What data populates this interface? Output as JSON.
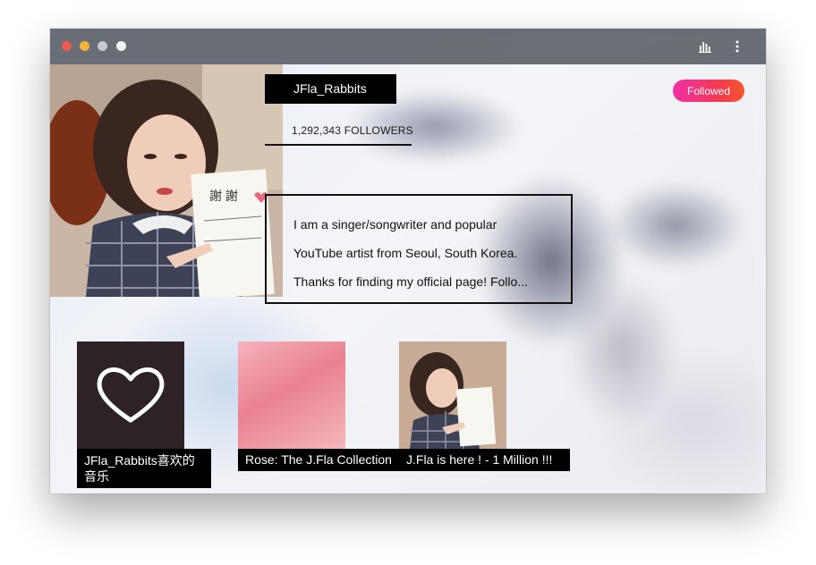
{
  "window": {
    "traffic_lights": [
      "close",
      "minimize",
      "zoom",
      "extra"
    ],
    "toolbar_icons": [
      "stats-bars-icon",
      "more-vertical-icon"
    ]
  },
  "artist": {
    "name": "JFla_Rabbits",
    "followers": "1,292,343 FOLLOWERS",
    "follow_label": "Followed",
    "bio_lines": [
      "I am a singer/songwriter and popular",
      "YouTube artist from Seoul, South Korea.",
      "Thanks for finding my official page! Follo..."
    ]
  },
  "playlists": [
    {
      "title": "JFla_Rabbits喜欢的音乐",
      "cover_text": "jfla.jpg"
    },
    {
      "title": "Rose: The J.Fla Collection"
    },
    {
      "title": "J.Fla is here !  - 1 Million !!!"
    }
  ],
  "colors": {
    "titlebar": "#5f636a",
    "follow_gradient_start": "#f12fa6",
    "follow_gradient_end": "#f4582d",
    "label_bg": "#000000"
  }
}
